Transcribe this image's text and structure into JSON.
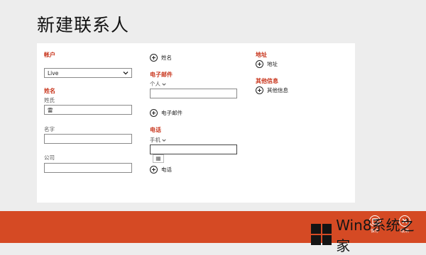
{
  "page": {
    "title": "新建联系人"
  },
  "account": {
    "section": "帐户",
    "selected": "Live"
  },
  "name": {
    "section": "姓名",
    "surname_label": "姓氏",
    "surname_value": "雷",
    "given_label": "名字",
    "given_value": "",
    "company_label": "公司",
    "company_value": ""
  },
  "middle": {
    "add_name": "姓名",
    "email_section": "电子邮件",
    "email_type": "个人",
    "email_value": "",
    "add_email": "电子邮件",
    "phone_section": "电话",
    "phone_type": "手机",
    "phone_value": "",
    "add_phone": "电话"
  },
  "right": {
    "address_section": "地址",
    "add_address": "地址",
    "other_section": "其他信息",
    "add_other": "其他信息"
  },
  "appbar": {
    "save_label": "保存",
    "cancel_label": "取消"
  },
  "watermark": {
    "text": "Win8系统之家"
  }
}
